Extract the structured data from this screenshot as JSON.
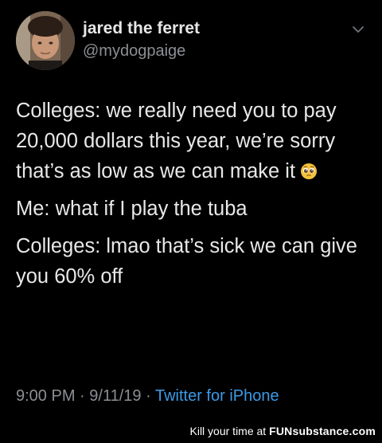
{
  "tweet": {
    "display_name": "jared the ferret",
    "handle": "@mydogpaige",
    "paragraphs": [
      "Colleges: we really need you to pay 20,000 dollars this year, we’re sorry that’s as low as we can make it",
      "Me: what if I play the tuba",
      "Colleges: lmao that’s sick we can give you 60% off"
    ],
    "emoji": "pleading-face",
    "time": "9:00 PM",
    "separator": "·",
    "date": "9/11/19",
    "source": "Twitter for iPhone"
  },
  "watermark": {
    "prefix": "Kill your time at",
    "brand": "FUNsubstance.com"
  },
  "colors": {
    "background": "#000000",
    "primary_text": "#e8e8e8",
    "secondary_text": "#8b8f93",
    "link": "#3b9ae6"
  },
  "icons": [
    "avatar-photo",
    "chevron-down-icon",
    "pleading-face-emoji"
  ]
}
